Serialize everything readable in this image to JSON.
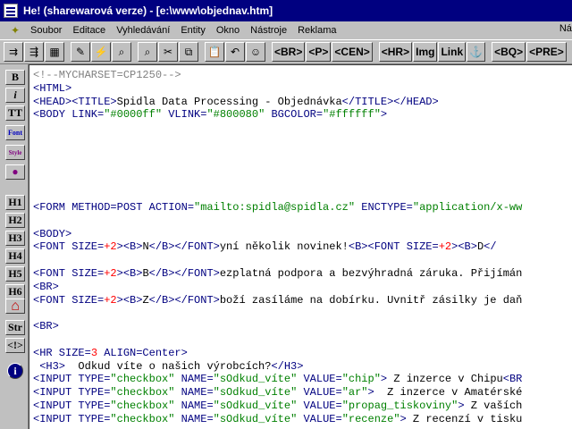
{
  "window": {
    "title": "He! (sharewarová verze) - [e:\\www\\objednav.htm]"
  },
  "menubar": {
    "items": [
      {
        "label": "Soubor"
      },
      {
        "label": "Editace"
      },
      {
        "label": "Vyhledávání"
      },
      {
        "label": "Entity"
      },
      {
        "label": "Okno"
      },
      {
        "label": "Nástroje"
      },
      {
        "label": "Reklama"
      }
    ],
    "right_label": "Náp"
  },
  "toolbar": {
    "icon_buttons": [
      {
        "name": "tile-windows-icon",
        "glyph": "⇉"
      },
      {
        "name": "cascade-windows-icon",
        "glyph": "⇶"
      },
      {
        "name": "image-icon",
        "glyph": "▦"
      },
      {
        "name": "paint-icon",
        "glyph": "✎"
      },
      {
        "name": "lightning-icon",
        "glyph": "⚡"
      },
      {
        "name": "binoculars-icon",
        "glyph": "⌕"
      },
      {
        "name": "binoculars-replace-icon",
        "glyph": "⌕"
      },
      {
        "name": "cut-icon",
        "glyph": "✂"
      },
      {
        "name": "copy-icon",
        "glyph": "⧉"
      },
      {
        "name": "paste-icon",
        "glyph": "📋"
      },
      {
        "name": "undo-icon",
        "glyph": "↶"
      },
      {
        "name": "face-icon",
        "glyph": "☺"
      }
    ],
    "tag_buttons": [
      {
        "name": "br-tag-button",
        "label": "<BR>"
      },
      {
        "name": "p-tag-button",
        "label": "<P>"
      },
      {
        "name": "center-tag-button",
        "label": "<CEN>"
      },
      {
        "name": "hr-tag-button",
        "label": "<HR>"
      },
      {
        "name": "img-tag-button",
        "label": "Img"
      },
      {
        "name": "link-tag-button",
        "label": "Link"
      },
      {
        "name": "anchor-tag-button",
        "label": "⚓"
      },
      {
        "name": "blockquote-tag-button",
        "label": "<BQ>"
      },
      {
        "name": "pre-tag-button",
        "label": "<PRE>"
      }
    ]
  },
  "left_toolbar": {
    "buttons": [
      {
        "name": "bold-button",
        "label": "B"
      },
      {
        "name": "italic-button",
        "label": "i"
      },
      {
        "name": "teletype-button",
        "label": "TT"
      },
      {
        "name": "font-button",
        "label": "Font"
      },
      {
        "name": "style-button",
        "label": "Style"
      },
      {
        "name": "bomb-button",
        "label": "●"
      },
      {
        "name": "h1-button",
        "label": "H1"
      },
      {
        "name": "h2-button",
        "label": "H2"
      },
      {
        "name": "h3-button",
        "label": "H3"
      },
      {
        "name": "h4-button",
        "label": "H4"
      },
      {
        "name": "h5-button",
        "label": "H5"
      },
      {
        "name": "h6-button",
        "label": "H6"
      },
      {
        "name": "home-button",
        "label": "⌂"
      },
      {
        "name": "strong-button",
        "label": "Str"
      },
      {
        "name": "comment-button",
        "label": "<!>"
      },
      {
        "name": "info-button",
        "label": "i"
      }
    ]
  },
  "editor": {
    "lines": [
      {
        "parts": [
          {
            "t": "<!--MYCHARSET=CP1250-->",
            "c": "comment"
          }
        ]
      },
      {
        "parts": [
          {
            "t": "<HTML>",
            "c": "tag"
          }
        ]
      },
      {
        "parts": [
          {
            "t": "<HEAD><TITLE>",
            "c": "tag"
          },
          {
            "t": "Spidla Data Processing - Objednávka",
            "c": "text"
          },
          {
            "t": "</TITLE></HEAD>",
            "c": "tag"
          }
        ]
      },
      {
        "parts": [
          {
            "t": "<BODY LINK=",
            "c": "tag"
          },
          {
            "t": "\"#0000ff\"",
            "c": "str"
          },
          {
            "t": " VLINK=",
            "c": "tag"
          },
          {
            "t": "\"#800080\"",
            "c": "str"
          },
          {
            "t": " BGCOLOR=",
            "c": "tag"
          },
          {
            "t": "\"#ffffff\"",
            "c": "str"
          },
          {
            "t": ">",
            "c": "tag"
          }
        ]
      },
      {
        "parts": []
      },
      {
        "parts": []
      },
      {
        "parts": []
      },
      {
        "parts": []
      },
      {
        "parts": []
      },
      {
        "parts": []
      },
      {
        "parts": [
          {
            "t": "<FORM METHOD=POST ACTION=",
            "c": "tag"
          },
          {
            "t": "\"mailto:spidla@spidla.cz\"",
            "c": "str"
          },
          {
            "t": " ENCTYPE=",
            "c": "tag"
          },
          {
            "t": "\"application/x-ww",
            "c": "str"
          }
        ]
      },
      {
        "parts": []
      },
      {
        "parts": [
          {
            "t": "<BODY>",
            "c": "tag"
          }
        ]
      },
      {
        "parts": [
          {
            "t": "<FONT SIZE=",
            "c": "tag"
          },
          {
            "t": "+2",
            "c": "num"
          },
          {
            "t": "><B>",
            "c": "tag"
          },
          {
            "t": "N",
            "c": "text"
          },
          {
            "t": "</B></FONT>",
            "c": "tag"
          },
          {
            "t": "yní několik novinek!",
            "c": "text"
          },
          {
            "t": "<B><FONT SIZE=",
            "c": "tag"
          },
          {
            "t": "+2",
            "c": "num"
          },
          {
            "t": "><B>",
            "c": "tag"
          },
          {
            "t": "D",
            "c": "text"
          },
          {
            "t": "</",
            "c": "tag"
          }
        ]
      },
      {
        "parts": []
      },
      {
        "parts": [
          {
            "t": "<FONT SIZE=",
            "c": "tag"
          },
          {
            "t": "+2",
            "c": "num"
          },
          {
            "t": "><B>",
            "c": "tag"
          },
          {
            "t": "B",
            "c": "text"
          },
          {
            "t": "</B></FONT>",
            "c": "tag"
          },
          {
            "t": "ezplatná podpora a bezvýhradná záruka. Přijímán",
            "c": "text"
          }
        ]
      },
      {
        "parts": [
          {
            "t": "<BR>",
            "c": "tag"
          }
        ]
      },
      {
        "parts": [
          {
            "t": "<FONT SIZE=",
            "c": "tag"
          },
          {
            "t": "+2",
            "c": "num"
          },
          {
            "t": "><B>",
            "c": "tag"
          },
          {
            "t": "Z",
            "c": "text"
          },
          {
            "t": "</B></FONT>",
            "c": "tag"
          },
          {
            "t": "boží zasíláme na dobírku. Uvnitř zásilky je daň",
            "c": "text"
          }
        ]
      },
      {
        "parts": []
      },
      {
        "parts": [
          {
            "t": "<BR>",
            "c": "tag"
          }
        ]
      },
      {
        "parts": []
      },
      {
        "parts": [
          {
            "t": "<HR SIZE=",
            "c": "tag"
          },
          {
            "t": "3",
            "c": "num"
          },
          {
            "t": " ALIGN=Center>",
            "c": "tag"
          }
        ]
      },
      {
        "parts": [
          {
            "t": " <H3>",
            "c": "tag"
          },
          {
            "t": "  Odkud víte o našich výrobcích?",
            "c": "text"
          },
          {
            "t": "</H3>",
            "c": "tag"
          }
        ]
      },
      {
        "parts": [
          {
            "t": "<INPUT TYPE=",
            "c": "tag"
          },
          {
            "t": "\"checkbox\"",
            "c": "str"
          },
          {
            "t": " NAME=",
            "c": "tag"
          },
          {
            "t": "\"sOdkud_víte\"",
            "c": "str"
          },
          {
            "t": " VALUE=",
            "c": "tag"
          },
          {
            "t": "\"chip\"",
            "c": "str"
          },
          {
            "t": ">",
            "c": "tag"
          },
          {
            "t": " Z inzerce v Chipu",
            "c": "text"
          },
          {
            "t": "<BR",
            "c": "tag"
          }
        ]
      },
      {
        "parts": [
          {
            "t": "<INPUT TYPE=",
            "c": "tag"
          },
          {
            "t": "\"checkbox\"",
            "c": "str"
          },
          {
            "t": " NAME=",
            "c": "tag"
          },
          {
            "t": "\"sOdkud_víte\"",
            "c": "str"
          },
          {
            "t": " VALUE=",
            "c": "tag"
          },
          {
            "t": "\"ar\"",
            "c": "str"
          },
          {
            "t": ">",
            "c": "tag"
          },
          {
            "t": "  Z inzerce v Amatérské",
            "c": "text"
          }
        ]
      },
      {
        "parts": [
          {
            "t": "<INPUT TYPE=",
            "c": "tag"
          },
          {
            "t": "\"checkbox\"",
            "c": "str"
          },
          {
            "t": " NAME=",
            "c": "tag"
          },
          {
            "t": "\"sOdkud_víte\"",
            "c": "str"
          },
          {
            "t": " VALUE=",
            "c": "tag"
          },
          {
            "t": "\"propag_tiskoviny\"",
            "c": "str"
          },
          {
            "t": ">",
            "c": "tag"
          },
          {
            "t": " Z vaších",
            "c": "text"
          }
        ]
      },
      {
        "parts": [
          {
            "t": "<INPUT TYPE=",
            "c": "tag"
          },
          {
            "t": "\"checkbox\"",
            "c": "str"
          },
          {
            "t": " NAME=",
            "c": "tag"
          },
          {
            "t": "\"sOdkud_víte\"",
            "c": "str"
          },
          {
            "t": " VALUE=",
            "c": "tag"
          },
          {
            "t": "\"recenze\"",
            "c": "str"
          },
          {
            "t": ">",
            "c": "tag"
          },
          {
            "t": " Z recenzí v tisku",
            "c": "text"
          }
        ]
      }
    ]
  }
}
